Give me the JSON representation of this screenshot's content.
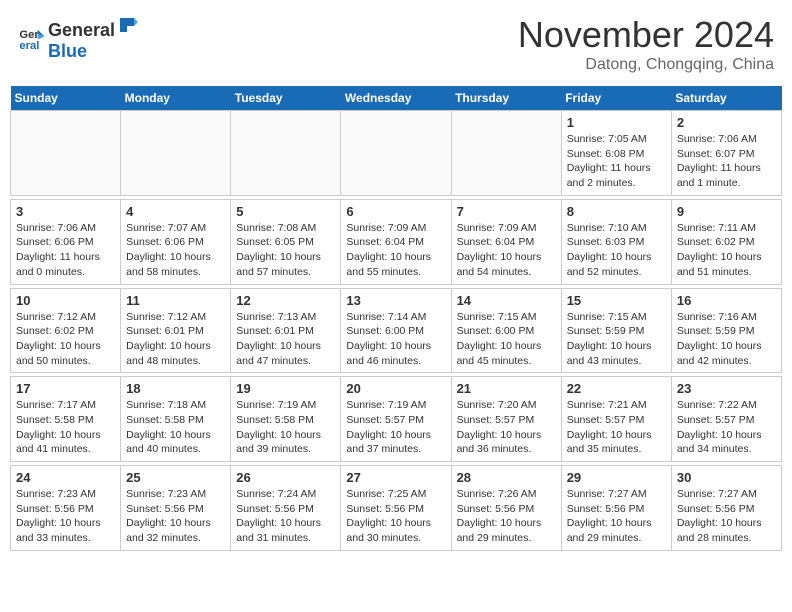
{
  "logo": {
    "general": "General",
    "blue": "Blue"
  },
  "title": "November 2024",
  "subtitle": "Datong, Chongqing, China",
  "weekdays": [
    "Sunday",
    "Monday",
    "Tuesday",
    "Wednesday",
    "Thursday",
    "Friday",
    "Saturday"
  ],
  "weeks": [
    [
      {
        "day": "",
        "info": ""
      },
      {
        "day": "",
        "info": ""
      },
      {
        "day": "",
        "info": ""
      },
      {
        "day": "",
        "info": ""
      },
      {
        "day": "",
        "info": ""
      },
      {
        "day": "1",
        "info": "Sunrise: 7:05 AM\nSunset: 6:08 PM\nDaylight: 11 hours and 2 minutes."
      },
      {
        "day": "2",
        "info": "Sunrise: 7:06 AM\nSunset: 6:07 PM\nDaylight: 11 hours and 1 minute."
      }
    ],
    [
      {
        "day": "3",
        "info": "Sunrise: 7:06 AM\nSunset: 6:06 PM\nDaylight: 11 hours and 0 minutes."
      },
      {
        "day": "4",
        "info": "Sunrise: 7:07 AM\nSunset: 6:06 PM\nDaylight: 10 hours and 58 minutes."
      },
      {
        "day": "5",
        "info": "Sunrise: 7:08 AM\nSunset: 6:05 PM\nDaylight: 10 hours and 57 minutes."
      },
      {
        "day": "6",
        "info": "Sunrise: 7:09 AM\nSunset: 6:04 PM\nDaylight: 10 hours and 55 minutes."
      },
      {
        "day": "7",
        "info": "Sunrise: 7:09 AM\nSunset: 6:04 PM\nDaylight: 10 hours and 54 minutes."
      },
      {
        "day": "8",
        "info": "Sunrise: 7:10 AM\nSunset: 6:03 PM\nDaylight: 10 hours and 52 minutes."
      },
      {
        "day": "9",
        "info": "Sunrise: 7:11 AM\nSunset: 6:02 PM\nDaylight: 10 hours and 51 minutes."
      }
    ],
    [
      {
        "day": "10",
        "info": "Sunrise: 7:12 AM\nSunset: 6:02 PM\nDaylight: 10 hours and 50 minutes."
      },
      {
        "day": "11",
        "info": "Sunrise: 7:12 AM\nSunset: 6:01 PM\nDaylight: 10 hours and 48 minutes."
      },
      {
        "day": "12",
        "info": "Sunrise: 7:13 AM\nSunset: 6:01 PM\nDaylight: 10 hours and 47 minutes."
      },
      {
        "day": "13",
        "info": "Sunrise: 7:14 AM\nSunset: 6:00 PM\nDaylight: 10 hours and 46 minutes."
      },
      {
        "day": "14",
        "info": "Sunrise: 7:15 AM\nSunset: 6:00 PM\nDaylight: 10 hours and 45 minutes."
      },
      {
        "day": "15",
        "info": "Sunrise: 7:15 AM\nSunset: 5:59 PM\nDaylight: 10 hours and 43 minutes."
      },
      {
        "day": "16",
        "info": "Sunrise: 7:16 AM\nSunset: 5:59 PM\nDaylight: 10 hours and 42 minutes."
      }
    ],
    [
      {
        "day": "17",
        "info": "Sunrise: 7:17 AM\nSunset: 5:58 PM\nDaylight: 10 hours and 41 minutes."
      },
      {
        "day": "18",
        "info": "Sunrise: 7:18 AM\nSunset: 5:58 PM\nDaylight: 10 hours and 40 minutes."
      },
      {
        "day": "19",
        "info": "Sunrise: 7:19 AM\nSunset: 5:58 PM\nDaylight: 10 hours and 39 minutes."
      },
      {
        "day": "20",
        "info": "Sunrise: 7:19 AM\nSunset: 5:57 PM\nDaylight: 10 hours and 37 minutes."
      },
      {
        "day": "21",
        "info": "Sunrise: 7:20 AM\nSunset: 5:57 PM\nDaylight: 10 hours and 36 minutes."
      },
      {
        "day": "22",
        "info": "Sunrise: 7:21 AM\nSunset: 5:57 PM\nDaylight: 10 hours and 35 minutes."
      },
      {
        "day": "23",
        "info": "Sunrise: 7:22 AM\nSunset: 5:57 PM\nDaylight: 10 hours and 34 minutes."
      }
    ],
    [
      {
        "day": "24",
        "info": "Sunrise: 7:23 AM\nSunset: 5:56 PM\nDaylight: 10 hours and 33 minutes."
      },
      {
        "day": "25",
        "info": "Sunrise: 7:23 AM\nSunset: 5:56 PM\nDaylight: 10 hours and 32 minutes."
      },
      {
        "day": "26",
        "info": "Sunrise: 7:24 AM\nSunset: 5:56 PM\nDaylight: 10 hours and 31 minutes."
      },
      {
        "day": "27",
        "info": "Sunrise: 7:25 AM\nSunset: 5:56 PM\nDaylight: 10 hours and 30 minutes."
      },
      {
        "day": "28",
        "info": "Sunrise: 7:26 AM\nSunset: 5:56 PM\nDaylight: 10 hours and 29 minutes."
      },
      {
        "day": "29",
        "info": "Sunrise: 7:27 AM\nSunset: 5:56 PM\nDaylight: 10 hours and 29 minutes."
      },
      {
        "day": "30",
        "info": "Sunrise: 7:27 AM\nSunset: 5:56 PM\nDaylight: 10 hours and 28 minutes."
      }
    ]
  ]
}
